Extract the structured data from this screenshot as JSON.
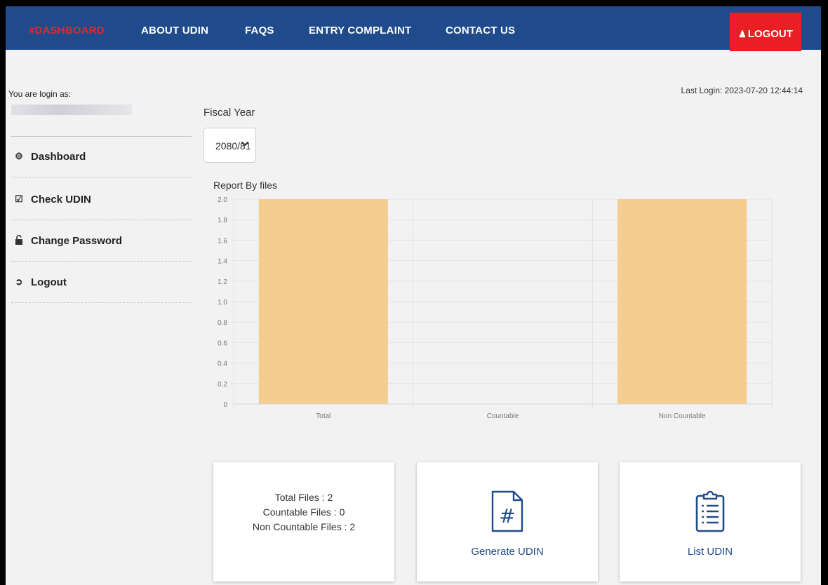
{
  "nav": {
    "dashboard": "#DASHBOARD",
    "about": "ABOUT UDIN",
    "faqs": "FAQS",
    "complaint": "ENTRY COMPLAINT",
    "contact": "CONTACT US",
    "logout": "LOGOUT"
  },
  "sidebar": {
    "login_label": "You are login as:",
    "items": [
      {
        "label": "Dashboard",
        "icon": "tachometer-icon"
      },
      {
        "label": "Check UDIN",
        "icon": "check-square-icon"
      },
      {
        "label": "Change Password",
        "icon": "lock-icon"
      },
      {
        "label": "Logout",
        "icon": "sign-out-icon"
      }
    ]
  },
  "header": {
    "last_login": "Last Login: 2023-07-20 12:44:14"
  },
  "filter": {
    "fiscal_year_label": "Fiscal Year",
    "fiscal_year_value": "2080/81"
  },
  "chart_data": {
    "type": "bar",
    "title": "Report By files",
    "categories": [
      "Total",
      "Countable",
      "Non Countable"
    ],
    "values": [
      2,
      0,
      2
    ],
    "ylim": [
      0,
      2.0
    ],
    "yticks": [
      "0",
      "0.2",
      "0.4",
      "0.6",
      "0.8",
      "1.0",
      "1.2",
      "1.4",
      "1.6",
      "1.8",
      "2.0"
    ],
    "bar_color": "#f5cd90",
    "grid": true
  },
  "cards": {
    "total_files": "Total Files : 2",
    "countable_files": "Countable Files : 0",
    "non_countable_files": "Non Countable Files : 2",
    "generate": "Generate UDIN",
    "list": "List UDIN"
  },
  "colors": {
    "navbar": "#1f4b8c",
    "logout": "#ea1f24",
    "active_nav": "#e3262b",
    "link": "#1f4b8c"
  }
}
